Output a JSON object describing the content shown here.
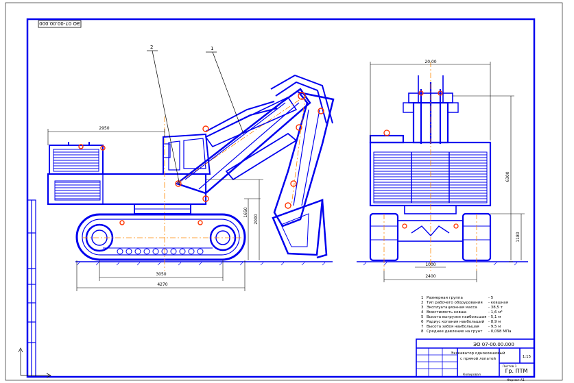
{
  "sheet": {
    "code_stamp": "ЭО 07-00.00.000",
    "colors": {
      "line": "#0000ee",
      "thin": "#000000",
      "axis": "#ff6600",
      "bg": "#ffffff"
    }
  },
  "leaders": {
    "l1": "1",
    "l2": "2"
  },
  "dimensions": {
    "d2950": "2950",
    "d3050": "3050",
    "d4270": "4270",
    "d1650": "1650",
    "d2000": "2000",
    "d20000": "20.00",
    "d6300": "6300",
    "d1180": "1180",
    "d2400": "2400",
    "d1000": "1000"
  },
  "specs": [
    {
      "n": "1",
      "text": "Размерная группа",
      "value": "- 5"
    },
    {
      "n": "2",
      "text": "Тип рабочего оборудования",
      "value": "- ковшная"
    },
    {
      "n": "3",
      "text": "Эксплуатационная масса",
      "value": "- 38,5 т"
    },
    {
      "n": "4",
      "text": "Вместимость ковша",
      "value": "- 1,6 м³"
    },
    {
      "n": "5",
      "text": "Высота выгрузки наибольшая",
      "value": "- 5,1 м"
    },
    {
      "n": "6",
      "text": "Радиус копания наибольший",
      "value": "- 8,9 м"
    },
    {
      "n": "7",
      "text": "Высота забоя наибольшая",
      "value": "- 9,5 м"
    },
    {
      "n": "8",
      "text": "Среднее давление на грунт",
      "value": "- 0,098 МПа"
    }
  ],
  "title_block": {
    "code": "ЭО 07-00.00.000",
    "title_line1": "Экскаватор одноковшовый",
    "title_line2": "с прямой лопатой",
    "scale": "1:15",
    "group": "Гр. ПТМ",
    "sheet_label": "Листов 1",
    "copied": "Копировал",
    "format": "Формат А1"
  }
}
